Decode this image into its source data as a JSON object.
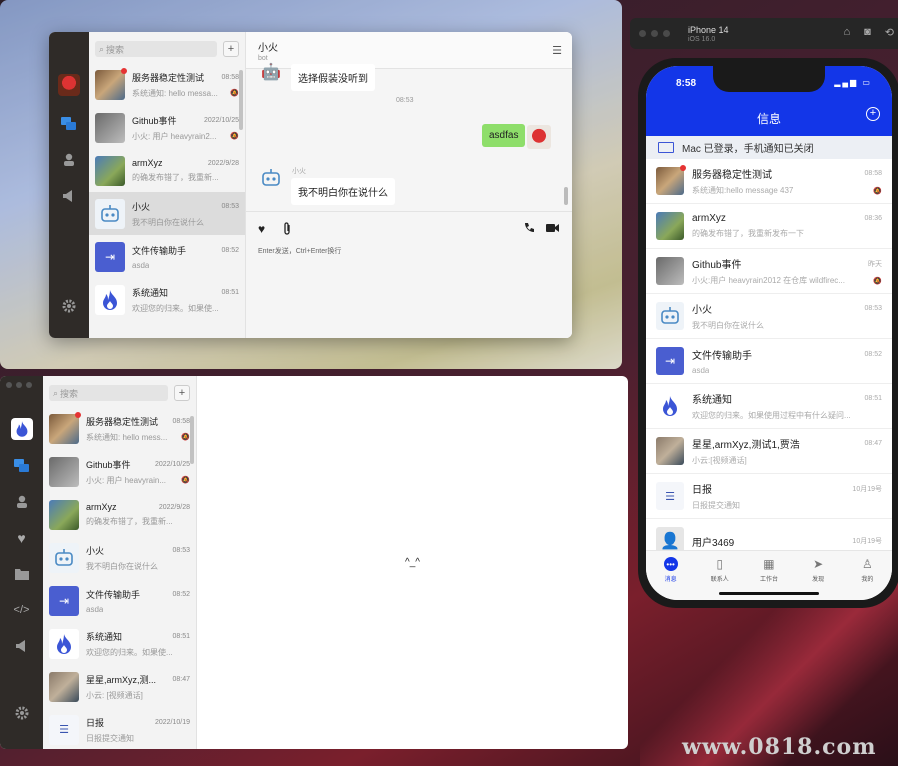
{
  "windowA": {
    "search_placeholder": "搜索",
    "add_label": "+",
    "chats": [
      {
        "name": "服务器稳定性测试",
        "time": "08:58",
        "preview": "系统通知: hello messa...",
        "muted": true,
        "unread": true,
        "icon": "group-photo"
      },
      {
        "name": "Github事件",
        "time": "2022/10/25",
        "preview": "小火: 用户 heavyrain2...",
        "muted": true,
        "icon": "github-photo"
      },
      {
        "name": "armXyz",
        "time": "2022/9/28",
        "preview": "的确发布错了，我重新...",
        "icon": "landscape-photo"
      },
      {
        "name": "小火",
        "time": "08:53",
        "preview": "我不明白你在说什么",
        "selected": true,
        "icon": "robot-icon"
      },
      {
        "name": "文件传输助手",
        "time": "08:52",
        "preview": "asda",
        "icon": "file-transfer-icon"
      },
      {
        "name": "系统通知",
        "time": "08:51",
        "preview": "欢迎您的归来。如果使...",
        "icon": "flame-icon"
      }
    ],
    "chat": {
      "title": "小火",
      "subtitle": "bot",
      "msg_top": "选择假装没听到",
      "timestamp": "08:53",
      "msg_me": "asdfas",
      "sender_name": "小火",
      "msg_bot": "我不明白你在说什么",
      "input_hint": "Enter发送，Ctrl+Enter换行"
    }
  },
  "windowB": {
    "search_placeholder": "搜索",
    "add_label": "+",
    "empty_face": "^_^",
    "chats": [
      {
        "name": "服务器稳定性测试",
        "time": "08:58",
        "preview": "系统通知: hello mess...",
        "muted": true,
        "unread": true
      },
      {
        "name": "Github事件",
        "time": "2022/10/25",
        "preview": "小火: 用户 heavyrain...",
        "muted": true
      },
      {
        "name": "armXyz",
        "time": "2022/9/28",
        "preview": "的确发布错了，我重新..."
      },
      {
        "name": "小火",
        "time": "08:53",
        "preview": "我不明白你在说什么"
      },
      {
        "name": "文件传输助手",
        "time": "08:52",
        "preview": "asda"
      },
      {
        "name": "系统通知",
        "time": "08:51",
        "preview": "欢迎您的归来。如果使..."
      },
      {
        "name": "星星,armXyz,测...",
        "time": "08:47",
        "preview": "小云: [视频通话]"
      },
      {
        "name": "日报",
        "time": "2022/10/19",
        "preview": "日报提交通知"
      }
    ]
  },
  "simulator": {
    "device": "iPhone 14",
    "os": "iOS 16.0"
  },
  "phone": {
    "clock": "8:58",
    "title": "信息",
    "banner": "Mac 已登录，手机通知已关闭",
    "chats": [
      {
        "name": "服务器稳定性测试",
        "time": "08:58",
        "preview": "系统通知:hello message 437",
        "muted": true,
        "unread": true
      },
      {
        "name": "armXyz",
        "time": "08:36",
        "preview": "的确发布错了，我重新发布一下"
      },
      {
        "name": "Github事件",
        "time": "昨天",
        "preview": "小火:用户 heavyrain2012 在仓库 wildfirec...",
        "muted": true
      },
      {
        "name": "小火",
        "time": "08:53",
        "preview": "我不明白你在说什么"
      },
      {
        "name": "文件传输助手",
        "time": "08:52",
        "preview": "asda"
      },
      {
        "name": "系统通知",
        "time": "08:51",
        "preview": "欢迎您的归来。如果使用过程中有什么疑问..."
      },
      {
        "name": "星星,armXyz,测试1,贾浩",
        "time": "08:47",
        "preview": "小云:[视频通话]"
      },
      {
        "name": "日报",
        "time": "10月19号",
        "preview": "日报提交通知"
      },
      {
        "name": "用户3469",
        "time": "10月19号",
        "preview": ""
      }
    ],
    "tabs": [
      {
        "label": "消息",
        "active": true
      },
      {
        "label": "联系人"
      },
      {
        "label": "工作台"
      },
      {
        "label": "发现"
      },
      {
        "label": "我的"
      }
    ]
  },
  "watermark": "www.0818.com",
  "colors": {
    "accent": "#1336e8",
    "bubble_me": "#8ede6a",
    "rail": "#2f2b28",
    "unread": "#e53333"
  }
}
